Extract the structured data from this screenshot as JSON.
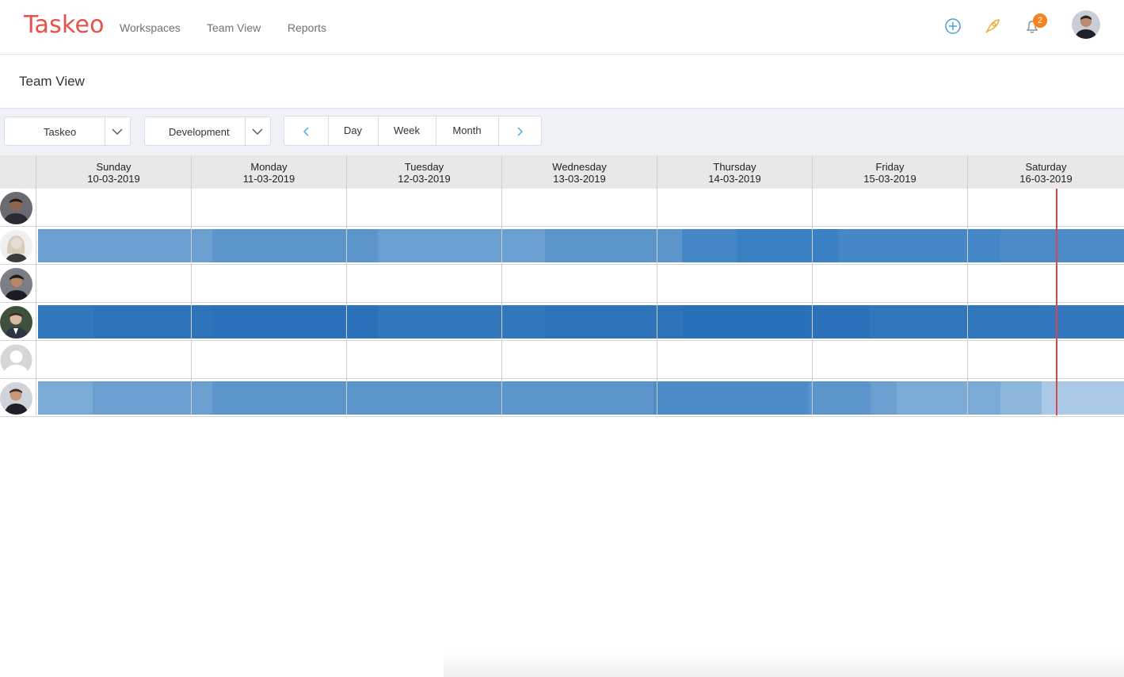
{
  "app": {
    "name": "Taskeo"
  },
  "nav": {
    "items": [
      "Workspaces",
      "Team View",
      "Reports"
    ]
  },
  "header": {
    "notification_count": "2",
    "icons": [
      "plus-circle-icon",
      "rocket-icon",
      "bell-icon"
    ]
  },
  "page": {
    "title": "Team View"
  },
  "toolbar": {
    "workspace_select": "Taskeo",
    "project_select": "Development",
    "views": [
      "Day",
      "Week",
      "Month"
    ]
  },
  "calendar": {
    "days": [
      {
        "name": "Sunday",
        "date": "10-03-2019"
      },
      {
        "name": "Monday",
        "date": "11-03-2019"
      },
      {
        "name": "Tuesday",
        "date": "12-03-2019"
      },
      {
        "name": "Wednesday",
        "date": "13-03-2019"
      },
      {
        "name": "Thursday",
        "date": "14-03-2019"
      },
      {
        "name": "Friday",
        "date": "15-03-2019"
      },
      {
        "name": "Saturday",
        "date": "16-03-2019"
      }
    ]
  },
  "colors": {
    "accent": "#e8514a",
    "badge": "#f5821f",
    "bar_base": "#3a7fc1",
    "today": "#d9474e"
  }
}
